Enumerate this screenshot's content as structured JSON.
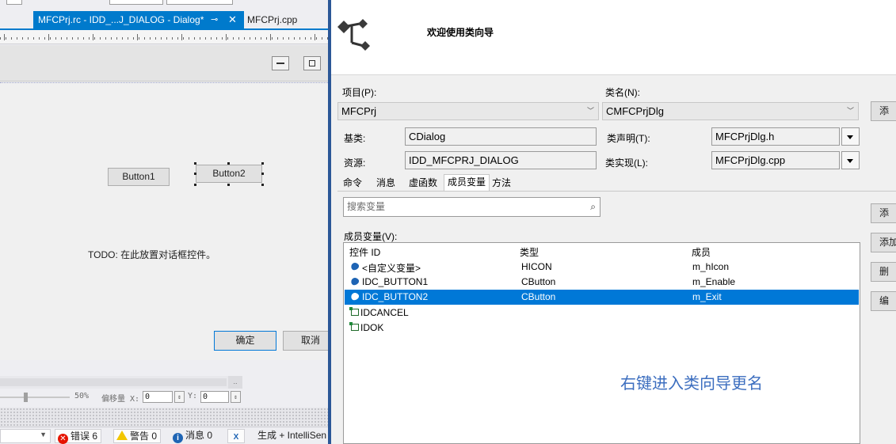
{
  "editor": {
    "tabs": {
      "active_label": "MFCPrj.rc - IDD_...J_DIALOG - Dialog*",
      "active_pin": "⊸",
      "active_close": "✕",
      "other_label": "MFCPrj.cpp"
    },
    "dialog": {
      "button1_label": "Button1",
      "button2_label": "Button2",
      "todo_text": "TODO: 在此放置对话框控件。",
      "ok_label": "确定",
      "cancel_label": "取消"
    },
    "zoom": {
      "scroll_dots": "..",
      "zoom_text": "50%",
      "offset_label": "偏移量 X:",
      "x_value": "0",
      "y_label": "Y:",
      "y_value": "0"
    },
    "error_list": {
      "errors_label": "错误 6",
      "warnings_label": "警告 0",
      "messages_label": "消息 0",
      "build_label": "生成 + IntelliSen"
    }
  },
  "wizard": {
    "heading": "欢迎使用类向导",
    "project_label": "项目(P):",
    "project_value": "MFCPrj",
    "classname_label": "类名(N):",
    "classname_value": "CMFCPrjDlg",
    "baseclass_label": "基类:",
    "baseclass_value": "CDialog",
    "resource_label": "资源:",
    "resource_value": "IDD_MFCPRJ_DIALOG",
    "decl_label": "类声明(T):",
    "decl_value": "MFCPrjDlg.h",
    "impl_label": "类实现(L):",
    "impl_value": "MFCPrjDlg.cpp",
    "side_buttons": [
      "添",
      "添",
      "添加",
      "删",
      "编"
    ],
    "tabs": [
      "命令",
      "消息",
      "虚函数",
      "成员变量",
      "方法"
    ],
    "search_placeholder": "搜索变量",
    "members_label": "成员变量(V):",
    "columns": [
      "控件 ID",
      "类型",
      "成员"
    ],
    "rows": [
      {
        "id": "<自定义变量>",
        "type": "HICON",
        "member": "m_hIcon"
      },
      {
        "id": "IDC_BUTTON1",
        "type": "CButton",
        "member": "m_Enable"
      },
      {
        "id": "IDC_BUTTON2",
        "type": "CButton",
        "member": "m_Exit"
      },
      {
        "id": "IDCANCEL",
        "type": "",
        "member": ""
      },
      {
        "id": "IDOK",
        "type": "",
        "member": ""
      }
    ],
    "selected_row": 2
  },
  "annotation": "右键进入类向导更名",
  "colors": {
    "accent": "#007acc",
    "selection": "#0078d7",
    "annotation": "#3c6ebf",
    "error": "#e51400",
    "warning": "#f2c600",
    "info": "#1e64b4"
  }
}
